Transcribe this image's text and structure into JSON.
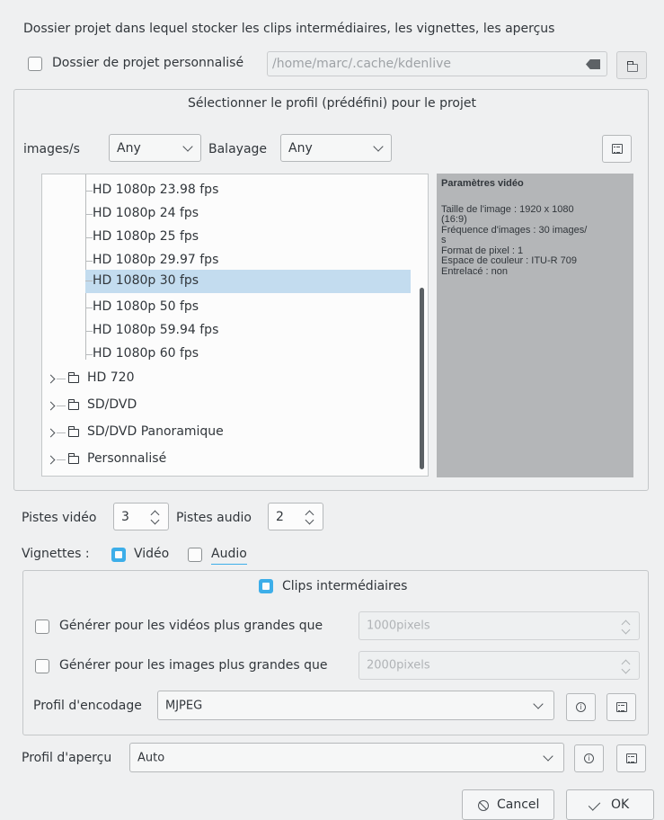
{
  "project_folder": {
    "description": "Dossier projet dans lequel stocker les clips intermédiaires, les vignettes, les aperçus",
    "custom_label": "Dossier de projet personnalisé",
    "custom_checked": false,
    "path_value": "/home/marc/.cache/kdenlive"
  },
  "profile": {
    "title": "Sélectionner le profil (prédéfini) pour le projet",
    "fps_label": "images/s",
    "fps_value": "Any",
    "scan_label": "Balayage",
    "scan_value": "Any",
    "tree_items": [
      "HD 1080p 23.98 fps",
      "HD 1080p 24 fps",
      "HD 1080p 25 fps",
      "HD 1080p 29.97 fps",
      "HD 1080p 30 fps",
      "HD 1080p 50 fps",
      "HD 1080p 59.94 fps",
      "HD 1080p 60 fps"
    ],
    "selected_item": "HD 1080p 30 fps",
    "tree_folders": [
      "HD 720",
      "SD/DVD",
      "SD/DVD Panoramique",
      "Personnalisé"
    ],
    "video_params_title": "Paramètres vidéo",
    "video_params_lines": [
      "Taille de l'image : 1920 x 1080",
      "(16:9)",
      "Fréquence d'images : 30 images/",
      "s",
      "Format de pixel : 1",
      "Espace de couleur : ITU-R 709",
      "Entrelacé : non"
    ]
  },
  "tracks": {
    "video_label": "Pistes vidéo",
    "video_value": "3",
    "audio_label": "Pistes audio",
    "audio_value": "2"
  },
  "thumbnails": {
    "label": "Vignettes :",
    "video_label": "Vidéo",
    "video_checked": true,
    "audio_label": "Audio",
    "audio_checked": false
  },
  "proxy": {
    "clips_label": "Clips intermédiaires",
    "clips_checked": true,
    "video_label": "Générer pour les vidéos plus grandes que",
    "video_value": "1000pixels",
    "image_label": "Générer pour les images plus grandes que",
    "image_value": "2000pixels",
    "encoding_label": "Profil d'encodage",
    "encoding_value": "MJPEG"
  },
  "preview": {
    "label": "Profil d'aperçu",
    "value": "Auto"
  },
  "buttons": {
    "cancel": "Cancel",
    "ok": "OK"
  },
  "colors": {
    "accent": "#3daee9",
    "selection": "#c3dcef",
    "info_panel": "#b4b6b8",
    "window_bg": "#eff0f1"
  }
}
